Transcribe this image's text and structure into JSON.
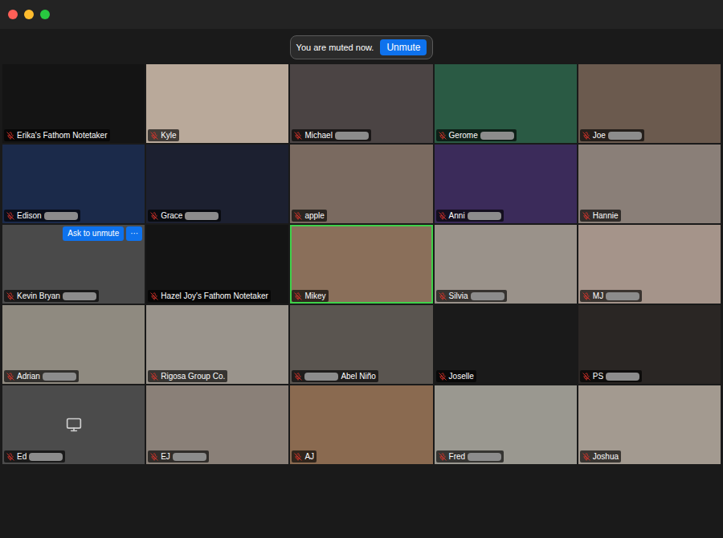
{
  "window": {
    "controls": [
      "close",
      "minimize",
      "zoom"
    ]
  },
  "banner": {
    "text": "You are muted now.",
    "button": "Unmute"
  },
  "tiles": [
    {
      "name": "Erika's Fathom Notetaker",
      "muted": true,
      "speaking": false,
      "redacted_before": false,
      "redacted_after": false,
      "kind": "video"
    },
    {
      "name": "Kyle",
      "muted": true,
      "speaking": false,
      "redacted_before": false,
      "redacted_after": false,
      "kind": "video"
    },
    {
      "name": "Michael",
      "muted": true,
      "speaking": false,
      "redacted_before": false,
      "redacted_after": true,
      "kind": "video"
    },
    {
      "name": "Gerome",
      "muted": true,
      "speaking": false,
      "redacted_before": false,
      "redacted_after": true,
      "kind": "video"
    },
    {
      "name": "Joe",
      "muted": true,
      "speaking": false,
      "redacted_before": false,
      "redacted_after": true,
      "kind": "video"
    },
    {
      "name": "Edison",
      "muted": true,
      "speaking": false,
      "redacted_before": false,
      "redacted_after": true,
      "kind": "video"
    },
    {
      "name": "Grace",
      "muted": true,
      "speaking": false,
      "redacted_before": false,
      "redacted_after": true,
      "kind": "video"
    },
    {
      "name": "apple",
      "muted": true,
      "speaking": false,
      "redacted_before": false,
      "redacted_after": false,
      "kind": "video"
    },
    {
      "name": "Anni",
      "muted": true,
      "speaking": false,
      "redacted_before": false,
      "redacted_after": true,
      "kind": "video"
    },
    {
      "name": "Hannie",
      "muted": true,
      "speaking": false,
      "redacted_before": false,
      "redacted_after": false,
      "kind": "video"
    },
    {
      "name": "Kevin Bryan",
      "muted": true,
      "speaking": false,
      "redacted_before": false,
      "redacted_after": true,
      "kind": "video",
      "hover_actions": {
        "ask": "Ask to unmute",
        "more": "···"
      }
    },
    {
      "name": "Hazel Joy's Fathom Notetaker",
      "muted": true,
      "speaking": false,
      "redacted_before": false,
      "redacted_after": false,
      "kind": "video"
    },
    {
      "name": "Mikey",
      "muted": true,
      "speaking": true,
      "redacted_before": false,
      "redacted_after": false,
      "kind": "video"
    },
    {
      "name": "Silvia",
      "muted": true,
      "speaking": false,
      "redacted_before": false,
      "redacted_after": true,
      "kind": "video"
    },
    {
      "name": "MJ",
      "muted": true,
      "speaking": false,
      "redacted_before": false,
      "redacted_after": true,
      "kind": "video"
    },
    {
      "name": "Adrian",
      "muted": true,
      "speaking": false,
      "redacted_before": false,
      "redacted_after": true,
      "kind": "video"
    },
    {
      "name": "Rigosa Group Co.",
      "muted": true,
      "speaking": false,
      "redacted_before": false,
      "redacted_after": false,
      "kind": "video"
    },
    {
      "name": "Abel Niño",
      "muted": true,
      "speaking": false,
      "redacted_before": true,
      "redacted_after": false,
      "kind": "video"
    },
    {
      "name": "Joselle",
      "muted": true,
      "speaking": false,
      "redacted_before": false,
      "redacted_after": false,
      "kind": "video"
    },
    {
      "name": "PS",
      "muted": true,
      "speaking": false,
      "redacted_before": false,
      "redacted_after": true,
      "kind": "video"
    },
    {
      "name": "Ed",
      "muted": true,
      "speaking": false,
      "redacted_before": false,
      "redacted_after": true,
      "kind": "camera-off"
    },
    {
      "name": "EJ",
      "muted": true,
      "speaking": false,
      "redacted_before": false,
      "redacted_after": true,
      "kind": "video"
    },
    {
      "name": "AJ",
      "muted": true,
      "speaking": false,
      "redacted_before": false,
      "redacted_after": false,
      "kind": "video"
    },
    {
      "name": "Fred",
      "muted": true,
      "speaking": false,
      "redacted_before": false,
      "redacted_after": true,
      "kind": "video"
    },
    {
      "name": "Joshua",
      "muted": true,
      "speaking": false,
      "redacted_before": false,
      "redacted_after": false,
      "kind": "video"
    }
  ]
}
